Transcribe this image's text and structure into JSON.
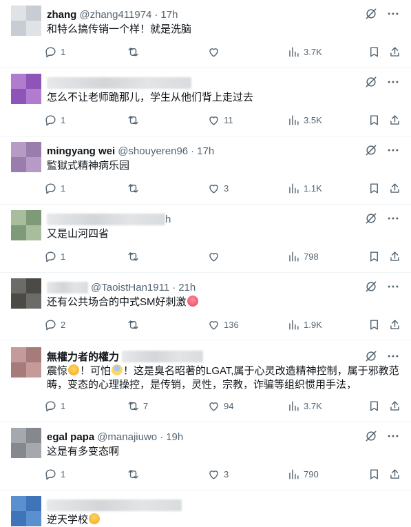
{
  "tweets": [
    {
      "name": "zhang",
      "handle": "@zhang411974",
      "time": "17h",
      "name_hidden": false,
      "text": "和特么搞传销一个样！就是洗脑",
      "replies": "1",
      "retweets": "",
      "likes": "",
      "views": "3.7K",
      "avatar_colors": [
        "#dfe3e6",
        "#c7cdd2"
      ]
    },
    {
      "name": "",
      "handle": "",
      "time": "",
      "name_hidden": true,
      "text": "怎么不让老师跪那儿，学生从他们背上走过去",
      "replies": "1",
      "retweets": "",
      "likes": "11",
      "views": "3.5K",
      "avatar_colors": [
        "#b07ccf",
        "#8e54b8"
      ]
    },
    {
      "name": "mingyang wei",
      "handle": "@shouyeren96",
      "time": "17h",
      "name_hidden": false,
      "text": "監獄式精神病乐园",
      "replies": "1",
      "retweets": "",
      "likes": "3",
      "views": "1.1K",
      "avatar_colors": [
        "#b69cc4",
        "#9a7cad"
      ]
    },
    {
      "name": "",
      "handle": "",
      "time": "h",
      "name_hidden": true,
      "text": "又是山河四省",
      "replies": "1",
      "retweets": "",
      "likes": "",
      "views": "798",
      "avatar_colors": [
        "#a7bd9c",
        "#7f9a78"
      ]
    },
    {
      "name": "",
      "handle": "@TaoistHan1911",
      "time": "21h",
      "name_hidden": true,
      "text": "还有公共场合的中式SM好刺激",
      "replies": "2",
      "retweets": "",
      "likes": "136",
      "views": "1.9K",
      "avatar_colors": [
        "#6b6b68",
        "#4b4a47"
      ]
    },
    {
      "name": "無權力者的權力",
      "handle": "",
      "time": "",
      "name_hidden": false,
      "text_lines": [
        "震惊",
        "！可怕",
        "！这是臭名昭著的LGAT,属于心灵改造精神控制，属于邪教范",
        "畴，变态的心理操控，是传销，灵性，宗教，诈骗等组织惯用手法，"
      ],
      "replies": "1",
      "retweets": "7",
      "likes": "94",
      "views": "3.7K",
      "avatar_colors": [
        "#c49a9a",
        "#a87b7b"
      ]
    },
    {
      "name": "egal papa",
      "handle": "@manajiuwo",
      "time": "19h",
      "name_hidden": false,
      "text": "这是有多变态啊",
      "replies": "1",
      "retweets": "",
      "likes": "3",
      "views": "790",
      "avatar_colors": [
        "#a5a8ad",
        "#85898f"
      ]
    },
    {
      "name": "",
      "handle": "",
      "time": "",
      "name_hidden": true,
      "text": "逆天学校",
      "replies": "",
      "retweets": "",
      "likes": "",
      "views": "",
      "avatar_colors": [
        "#5a8fd0",
        "#3f74b8"
      ]
    }
  ]
}
